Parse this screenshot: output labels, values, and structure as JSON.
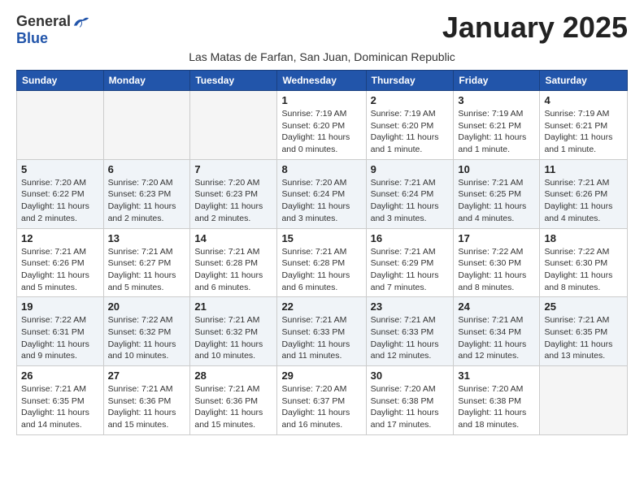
{
  "logo": {
    "general": "General",
    "blue": "Blue"
  },
  "title": "January 2025",
  "subtitle": "Las Matas de Farfan, San Juan, Dominican Republic",
  "days_of_week": [
    "Sunday",
    "Monday",
    "Tuesday",
    "Wednesday",
    "Thursday",
    "Friday",
    "Saturday"
  ],
  "weeks": [
    [
      {
        "day": "",
        "sunrise": "",
        "sunset": "",
        "daylight": ""
      },
      {
        "day": "",
        "sunrise": "",
        "sunset": "",
        "daylight": ""
      },
      {
        "day": "",
        "sunrise": "",
        "sunset": "",
        "daylight": ""
      },
      {
        "day": "1",
        "sunrise": "Sunrise: 7:19 AM",
        "sunset": "Sunset: 6:20 PM",
        "daylight": "Daylight: 11 hours and 0 minutes."
      },
      {
        "day": "2",
        "sunrise": "Sunrise: 7:19 AM",
        "sunset": "Sunset: 6:20 PM",
        "daylight": "Daylight: 11 hours and 1 minute."
      },
      {
        "day": "3",
        "sunrise": "Sunrise: 7:19 AM",
        "sunset": "Sunset: 6:21 PM",
        "daylight": "Daylight: 11 hours and 1 minute."
      },
      {
        "day": "4",
        "sunrise": "Sunrise: 7:19 AM",
        "sunset": "Sunset: 6:21 PM",
        "daylight": "Daylight: 11 hours and 1 minute."
      }
    ],
    [
      {
        "day": "5",
        "sunrise": "Sunrise: 7:20 AM",
        "sunset": "Sunset: 6:22 PM",
        "daylight": "Daylight: 11 hours and 2 minutes."
      },
      {
        "day": "6",
        "sunrise": "Sunrise: 7:20 AM",
        "sunset": "Sunset: 6:23 PM",
        "daylight": "Daylight: 11 hours and 2 minutes."
      },
      {
        "day": "7",
        "sunrise": "Sunrise: 7:20 AM",
        "sunset": "Sunset: 6:23 PM",
        "daylight": "Daylight: 11 hours and 2 minutes."
      },
      {
        "day": "8",
        "sunrise": "Sunrise: 7:20 AM",
        "sunset": "Sunset: 6:24 PM",
        "daylight": "Daylight: 11 hours and 3 minutes."
      },
      {
        "day": "9",
        "sunrise": "Sunrise: 7:21 AM",
        "sunset": "Sunset: 6:24 PM",
        "daylight": "Daylight: 11 hours and 3 minutes."
      },
      {
        "day": "10",
        "sunrise": "Sunrise: 7:21 AM",
        "sunset": "Sunset: 6:25 PM",
        "daylight": "Daylight: 11 hours and 4 minutes."
      },
      {
        "day": "11",
        "sunrise": "Sunrise: 7:21 AM",
        "sunset": "Sunset: 6:26 PM",
        "daylight": "Daylight: 11 hours and 4 minutes."
      }
    ],
    [
      {
        "day": "12",
        "sunrise": "Sunrise: 7:21 AM",
        "sunset": "Sunset: 6:26 PM",
        "daylight": "Daylight: 11 hours and 5 minutes."
      },
      {
        "day": "13",
        "sunrise": "Sunrise: 7:21 AM",
        "sunset": "Sunset: 6:27 PM",
        "daylight": "Daylight: 11 hours and 5 minutes."
      },
      {
        "day": "14",
        "sunrise": "Sunrise: 7:21 AM",
        "sunset": "Sunset: 6:28 PM",
        "daylight": "Daylight: 11 hours and 6 minutes."
      },
      {
        "day": "15",
        "sunrise": "Sunrise: 7:21 AM",
        "sunset": "Sunset: 6:28 PM",
        "daylight": "Daylight: 11 hours and 6 minutes."
      },
      {
        "day": "16",
        "sunrise": "Sunrise: 7:21 AM",
        "sunset": "Sunset: 6:29 PM",
        "daylight": "Daylight: 11 hours and 7 minutes."
      },
      {
        "day": "17",
        "sunrise": "Sunrise: 7:22 AM",
        "sunset": "Sunset: 6:30 PM",
        "daylight": "Daylight: 11 hours and 8 minutes."
      },
      {
        "day": "18",
        "sunrise": "Sunrise: 7:22 AM",
        "sunset": "Sunset: 6:30 PM",
        "daylight": "Daylight: 11 hours and 8 minutes."
      }
    ],
    [
      {
        "day": "19",
        "sunrise": "Sunrise: 7:22 AM",
        "sunset": "Sunset: 6:31 PM",
        "daylight": "Daylight: 11 hours and 9 minutes."
      },
      {
        "day": "20",
        "sunrise": "Sunrise: 7:22 AM",
        "sunset": "Sunset: 6:32 PM",
        "daylight": "Daylight: 11 hours and 10 minutes."
      },
      {
        "day": "21",
        "sunrise": "Sunrise: 7:21 AM",
        "sunset": "Sunset: 6:32 PM",
        "daylight": "Daylight: 11 hours and 10 minutes."
      },
      {
        "day": "22",
        "sunrise": "Sunrise: 7:21 AM",
        "sunset": "Sunset: 6:33 PM",
        "daylight": "Daylight: 11 hours and 11 minutes."
      },
      {
        "day": "23",
        "sunrise": "Sunrise: 7:21 AM",
        "sunset": "Sunset: 6:33 PM",
        "daylight": "Daylight: 11 hours and 12 minutes."
      },
      {
        "day": "24",
        "sunrise": "Sunrise: 7:21 AM",
        "sunset": "Sunset: 6:34 PM",
        "daylight": "Daylight: 11 hours and 12 minutes."
      },
      {
        "day": "25",
        "sunrise": "Sunrise: 7:21 AM",
        "sunset": "Sunset: 6:35 PM",
        "daylight": "Daylight: 11 hours and 13 minutes."
      }
    ],
    [
      {
        "day": "26",
        "sunrise": "Sunrise: 7:21 AM",
        "sunset": "Sunset: 6:35 PM",
        "daylight": "Daylight: 11 hours and 14 minutes."
      },
      {
        "day": "27",
        "sunrise": "Sunrise: 7:21 AM",
        "sunset": "Sunset: 6:36 PM",
        "daylight": "Daylight: 11 hours and 15 minutes."
      },
      {
        "day": "28",
        "sunrise": "Sunrise: 7:21 AM",
        "sunset": "Sunset: 6:36 PM",
        "daylight": "Daylight: 11 hours and 15 minutes."
      },
      {
        "day": "29",
        "sunrise": "Sunrise: 7:20 AM",
        "sunset": "Sunset: 6:37 PM",
        "daylight": "Daylight: 11 hours and 16 minutes."
      },
      {
        "day": "30",
        "sunrise": "Sunrise: 7:20 AM",
        "sunset": "Sunset: 6:38 PM",
        "daylight": "Daylight: 11 hours and 17 minutes."
      },
      {
        "day": "31",
        "sunrise": "Sunrise: 7:20 AM",
        "sunset": "Sunset: 6:38 PM",
        "daylight": "Daylight: 11 hours and 18 minutes."
      },
      {
        "day": "",
        "sunrise": "",
        "sunset": "",
        "daylight": ""
      }
    ]
  ]
}
